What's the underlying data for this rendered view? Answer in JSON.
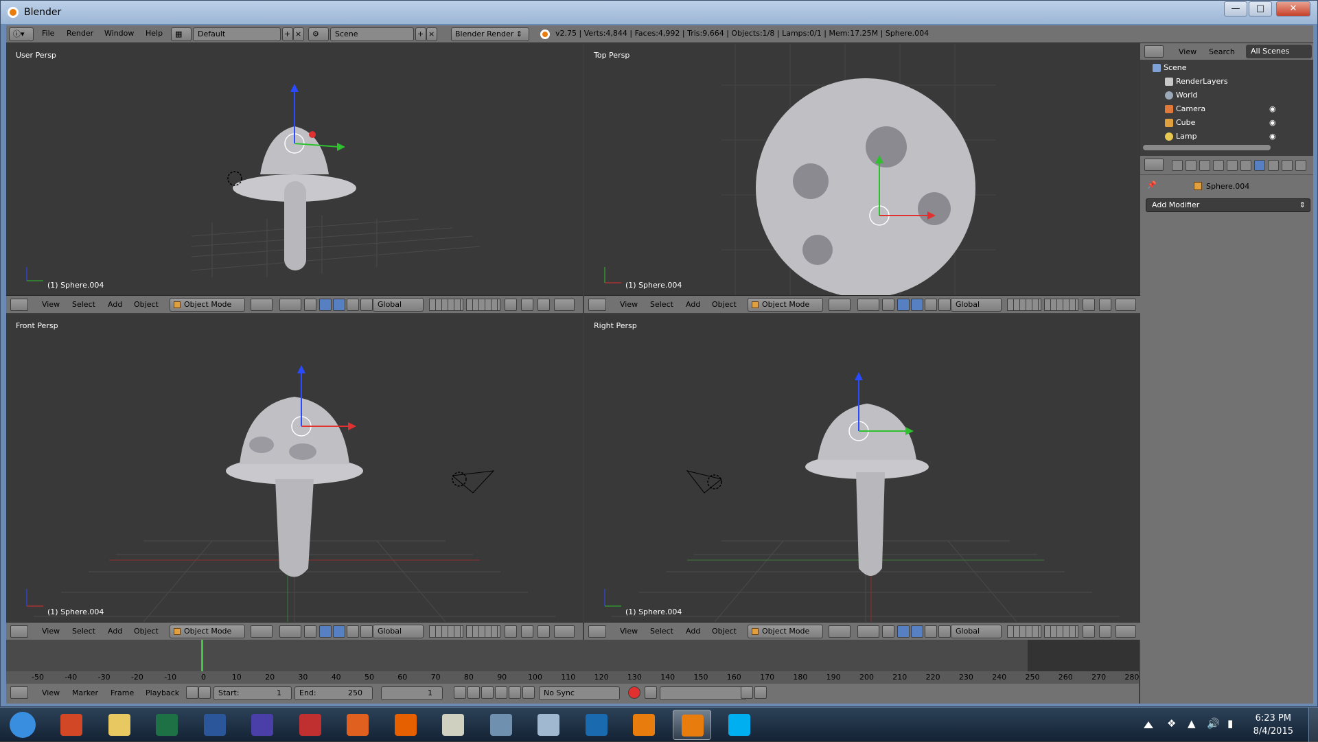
{
  "window": {
    "title": "Blender"
  },
  "infobar": {
    "menus": [
      "File",
      "Render",
      "Window",
      "Help"
    ],
    "layout": "Default",
    "scene": "Scene",
    "engine": "Blender Render",
    "stats": "v2.75 | Verts:4,844 | Faces:4,992 | Tris:9,664 | Objects:1/8 | Lamps:0/1 | Mem:17.25M | Sphere.004"
  },
  "viewports": [
    {
      "label": "User Persp",
      "object": "(1) Sphere.004"
    },
    {
      "label": "Top Persp",
      "object": "(1) Sphere.004"
    },
    {
      "label": "Front Persp",
      "object": "(1) Sphere.004"
    },
    {
      "label": "Right Persp",
      "object": "(1) Sphere.004"
    }
  ],
  "viewheader": {
    "menus": [
      "View",
      "Select",
      "Add",
      "Object"
    ],
    "mode": "Object Mode",
    "orientation": "Global"
  },
  "outliner": {
    "menus": [
      "View",
      "Search"
    ],
    "scene_filter": "All Scenes",
    "items": [
      {
        "label": "Scene",
        "icon": "scene-icon",
        "color": "#7fa2d6"
      },
      {
        "label": "RenderLayers",
        "icon": "renderlayers-icon",
        "color": "#c8c8c8"
      },
      {
        "label": "World",
        "icon": "world-icon",
        "color": "#9aa8b8"
      },
      {
        "label": "Camera",
        "icon": "camera-icon",
        "color": "#e07a3a"
      },
      {
        "label": "Cube",
        "icon": "mesh-icon",
        "color": "#e0a040"
      },
      {
        "label": "Lamp",
        "icon": "lamp-icon",
        "color": "#e8c850"
      }
    ]
  },
  "properties": {
    "object": "Sphere.004",
    "add_modifier": "Add Modifier"
  },
  "timeline": {
    "ticks": [
      "-50",
      "-40",
      "-30",
      "-20",
      "-10",
      "0",
      "10",
      "20",
      "30",
      "40",
      "50",
      "60",
      "70",
      "80",
      "90",
      "100",
      "110",
      "120",
      "130",
      "140",
      "150",
      "160",
      "170",
      "180",
      "190",
      "200",
      "210",
      "220",
      "230",
      "240",
      "250",
      "260",
      "270",
      "280"
    ],
    "menus": [
      "View",
      "Marker",
      "Frame",
      "Playback"
    ],
    "start": "Start:",
    "start_val": "1",
    "end": "End:",
    "end_val": "250",
    "current": "1",
    "sync": "No Sync"
  },
  "taskbar": {
    "apps": [
      {
        "name": "start-button",
        "color": "#3a8ee0"
      },
      {
        "name": "powerpoint-icon",
        "color": "#d24726"
      },
      {
        "name": "file-explorer-icon",
        "color": "#e8c860"
      },
      {
        "name": "excel-icon",
        "color": "#1e7145"
      },
      {
        "name": "word-icon",
        "color": "#2b579a"
      },
      {
        "name": "media-app-icon",
        "color": "#4a3ea8"
      },
      {
        "name": "document-app-icon",
        "color": "#c03030"
      },
      {
        "name": "matlab-icon",
        "color": "#e06020"
      },
      {
        "name": "firefox-icon",
        "color": "#e66000"
      },
      {
        "name": "notepad-icon",
        "color": "#d0d0c0"
      },
      {
        "name": "image-viewer-icon",
        "color": "#7090b0"
      },
      {
        "name": "files-icon",
        "color": "#a0b8d0"
      },
      {
        "name": "hp-icon",
        "color": "#1a6ab0"
      },
      {
        "name": "blender-icon",
        "color": "#e87d0d"
      },
      {
        "name": "blender-active-icon",
        "color": "#e87d0d"
      },
      {
        "name": "skype-icon",
        "color": "#00aff0"
      }
    ],
    "time": "6:23 PM",
    "date": "8/4/2015"
  }
}
